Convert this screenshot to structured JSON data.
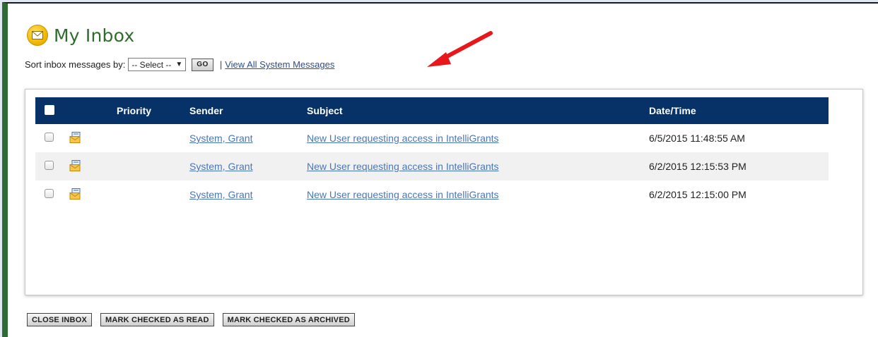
{
  "header": {
    "title": "My Inbox",
    "icon": "envelope-circle-icon",
    "accent_color": "#2f6d2f"
  },
  "sort": {
    "label": "Sort inbox messages by:",
    "selected": "-- Select --",
    "go_label": "GO",
    "separator": "|",
    "system_messages_link": "View All System Messages"
  },
  "table": {
    "header_color": "#073268",
    "columns": {
      "priority": "Priority",
      "sender": "Sender",
      "subject": "Subject",
      "datetime": "Date/Time"
    },
    "rows": [
      {
        "sender": "System, Grant",
        "subject": "New User requesting access in IntelliGrants",
        "datetime": "6/5/2015 11:48:55 AM"
      },
      {
        "sender": "System, Grant",
        "subject": "New User requesting access in IntelliGrants",
        "datetime": "6/2/2015 12:15:53 PM"
      },
      {
        "sender": "System, Grant",
        "subject": "New User requesting access in IntelliGrants",
        "datetime": "6/2/2015 12:15:00 PM"
      }
    ]
  },
  "footer": {
    "close_label": "CLOSE INBOX",
    "mark_read_label": "MARK CHECKED AS READ",
    "mark_archived_label": "MARK CHECKED AS ARCHIVED"
  },
  "annotation": {
    "arrow_color": "#e8171b",
    "icon": "red-arrow-icon"
  }
}
